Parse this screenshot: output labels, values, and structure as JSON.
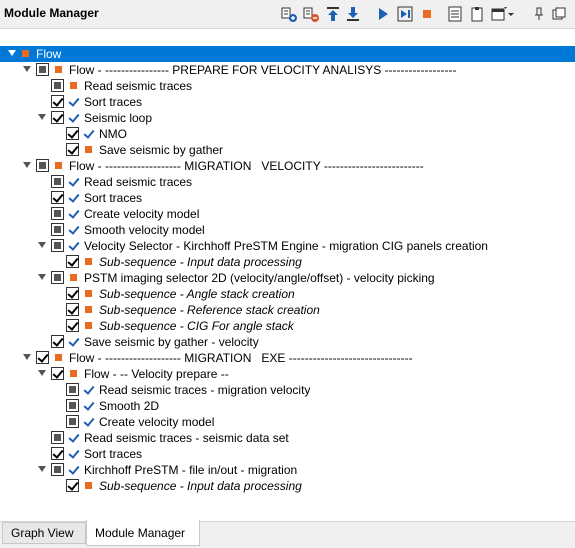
{
  "window": {
    "title": "Module Manager"
  },
  "toolbar": {
    "icons": [
      "add-module-icon",
      "remove-module-icon",
      "move-up-icon",
      "move-down-icon",
      "run-icon",
      "run-step-icon",
      "stop-icon",
      "list-icon",
      "clipboard-icon",
      "window-menu-icon",
      "pin-icon",
      "float-icon"
    ]
  },
  "tree": {
    "rows": [
      {
        "label": "Flow",
        "level": 0,
        "expand": true,
        "checkbox": "none",
        "marker": "square",
        "italic": false,
        "selected": true
      },
      {
        "label": "Flow - ---------------- PREPARE FOR VELOCITY ANALISYS ------------------",
        "level": 1,
        "expand": true,
        "checkbox": "partial",
        "marker": "square",
        "italic": false
      },
      {
        "label": "Read seismic traces",
        "level": 2,
        "expand": false,
        "checkbox": "partial",
        "marker": "square",
        "italic": false
      },
      {
        "label": "Sort traces",
        "level": 2,
        "expand": false,
        "checkbox": "checked",
        "marker": "check",
        "italic": false
      },
      {
        "label": "Seismic loop",
        "level": 2,
        "expand": true,
        "checkbox": "checked",
        "marker": "check",
        "italic": false
      },
      {
        "label": "NMO",
        "level": 3,
        "expand": false,
        "checkbox": "checked",
        "marker": "check",
        "italic": false
      },
      {
        "label": "Save seismic by gather",
        "level": 3,
        "expand": false,
        "checkbox": "checked",
        "marker": "square",
        "italic": false
      },
      {
        "label": "Flow - ------------------- MIGRATION   VELOCITY -------------------------",
        "level": 1,
        "expand": true,
        "checkbox": "partial",
        "marker": "square",
        "italic": false
      },
      {
        "label": "Read seismic traces",
        "level": 2,
        "expand": false,
        "checkbox": "partial",
        "marker": "check",
        "italic": false
      },
      {
        "label": "Sort traces",
        "level": 2,
        "expand": false,
        "checkbox": "checked",
        "marker": "check",
        "italic": false
      },
      {
        "label": "Create velocity model",
        "level": 2,
        "expand": false,
        "checkbox": "partial",
        "marker": "check",
        "italic": false
      },
      {
        "label": "Smooth velocity model",
        "level": 2,
        "expand": false,
        "checkbox": "partial",
        "marker": "check",
        "italic": false
      },
      {
        "label": "Velocity Selector - Kirchhoff PreSTM Engine - migration CIG panels creation",
        "level": 2,
        "expand": true,
        "checkbox": "partial",
        "marker": "check",
        "italic": false
      },
      {
        "label": "Sub-sequence - Input data processing",
        "level": 3,
        "expand": false,
        "checkbox": "checked",
        "marker": "square",
        "italic": true
      },
      {
        "label": "PSTM imaging selector 2D (velocity/angle/offset) - velocity picking",
        "level": 2,
        "expand": true,
        "checkbox": "partial",
        "marker": "square",
        "italic": false
      },
      {
        "label": "Sub-sequence - Angle stack creation",
        "level": 3,
        "expand": false,
        "checkbox": "checked",
        "marker": "square",
        "italic": true
      },
      {
        "label": "Sub-sequence - Reference stack creation",
        "level": 3,
        "expand": false,
        "checkbox": "checked",
        "marker": "square",
        "italic": true
      },
      {
        "label": "Sub-sequence - CIG For angle stack",
        "level": 3,
        "expand": false,
        "checkbox": "checked",
        "marker": "square",
        "italic": true
      },
      {
        "label": "Save seismic by gather - velocity",
        "level": 2,
        "expand": false,
        "checkbox": "checked",
        "marker": "check",
        "italic": false
      },
      {
        "label": "Flow - ------------------- MIGRATION   EXE -------------------------------",
        "level": 1,
        "expand": true,
        "checkbox": "checked",
        "marker": "square",
        "italic": false
      },
      {
        "label": "Flow - -- Velocity prepare --",
        "level": 2,
        "expand": true,
        "checkbox": "checked",
        "marker": "square",
        "italic": false
      },
      {
        "label": "Read seismic traces - migration velocity",
        "level": 3,
        "expand": false,
        "checkbox": "partial",
        "marker": "check",
        "italic": false
      },
      {
        "label": "Smooth 2D",
        "level": 3,
        "expand": false,
        "checkbox": "partial",
        "marker": "check",
        "italic": false
      },
      {
        "label": "Create velocity model",
        "level": 3,
        "expand": false,
        "checkbox": "partial",
        "marker": "check",
        "italic": false
      },
      {
        "label": "Read seismic traces - seismic data set",
        "level": 2,
        "expand": false,
        "checkbox": "partial",
        "marker": "check",
        "italic": false
      },
      {
        "label": "Sort traces",
        "level": 2,
        "expand": false,
        "checkbox": "checked",
        "marker": "check",
        "italic": false
      },
      {
        "label": "Kirchhoff PreSTM - file in/out - migration",
        "level": 2,
        "expand": true,
        "checkbox": "partial",
        "marker": "check",
        "italic": false
      },
      {
        "label": "Sub-sequence - Input data processing",
        "level": 3,
        "expand": false,
        "checkbox": "checked",
        "marker": "square",
        "italic": true
      }
    ]
  },
  "tabs": [
    {
      "label": "Graph View",
      "active": false
    },
    {
      "label": "Module Manager",
      "active": true
    }
  ],
  "colors": {
    "selection": "#0078d7",
    "marker_square": "#e86b1f",
    "marker_check": "#1f5fb4"
  }
}
